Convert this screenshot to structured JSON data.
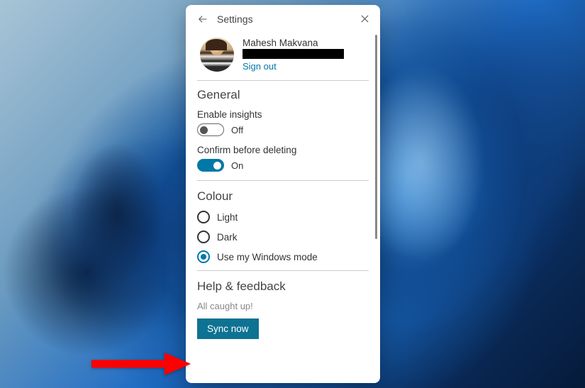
{
  "header": {
    "title": "Settings"
  },
  "profile": {
    "name": "Mahesh Makvana",
    "sign_out": "Sign out"
  },
  "sections": {
    "general": {
      "title": "General",
      "enable_insights": {
        "label": "Enable insights",
        "state": "Off"
      },
      "confirm_delete": {
        "label": "Confirm before deleting",
        "state": "On"
      }
    },
    "colour": {
      "title": "Colour",
      "options": {
        "light": "Light",
        "dark": "Dark",
        "windows": "Use my Windows mode"
      }
    },
    "help": {
      "title": "Help & feedback",
      "status": "All caught up!",
      "sync_button": "Sync now"
    }
  }
}
